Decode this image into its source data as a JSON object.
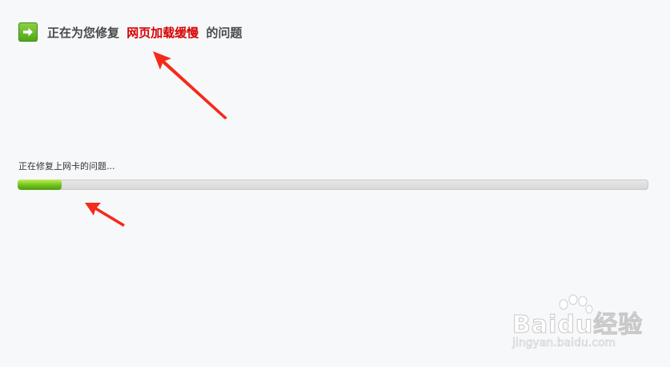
{
  "header": {
    "icon": "arrow-right-icon",
    "title_prefix": "正在为您修复",
    "title_highlight": "网页加载缓慢",
    "title_suffix": "的问题",
    "highlight_color": "#d60000"
  },
  "progress": {
    "status_text": "正在修复上网卡的问题...",
    "value_percent": 7
  },
  "watermark": {
    "logo": "Baidu经验",
    "url": "jingyan.baidu.com"
  }
}
